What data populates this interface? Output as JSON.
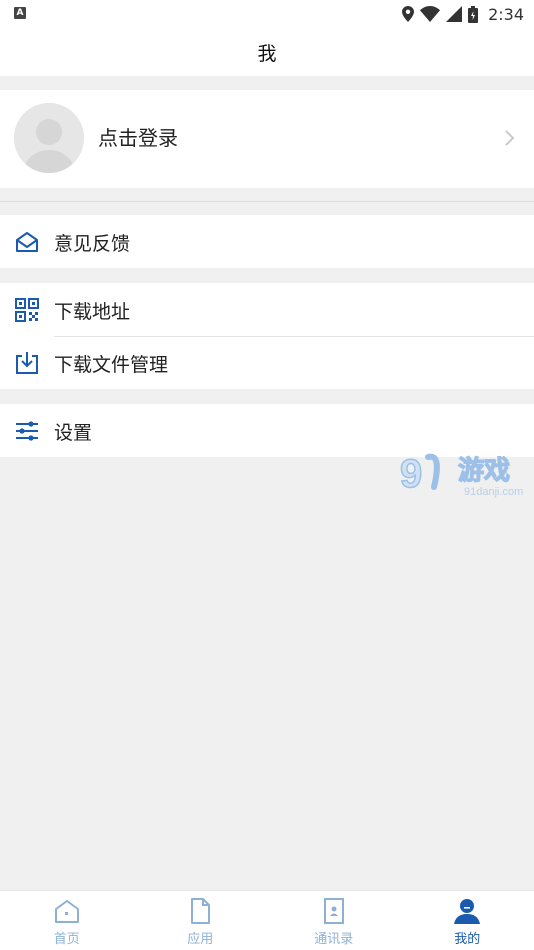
{
  "status_bar": {
    "left_badge": "A",
    "time": "2:34",
    "icons": [
      "location-icon",
      "wifi-icon",
      "signal-icon",
      "battery-icon"
    ]
  },
  "header": {
    "title": "我"
  },
  "profile": {
    "login_label": "点击登录",
    "avatar_icon": "avatar-placeholder"
  },
  "menu": {
    "group1": [
      {
        "label": "意见反馈",
        "icon": "mail-open-icon"
      }
    ],
    "group2": [
      {
        "label": "下载地址",
        "icon": "qr-code-icon"
      },
      {
        "label": "下载文件管理",
        "icon": "download-tray-icon"
      }
    ],
    "group3": [
      {
        "label": "设置",
        "icon": "sliders-icon"
      }
    ]
  },
  "watermark": {
    "brand": "9",
    "text": "游戏",
    "url": "91danji.com"
  },
  "bottom_nav": [
    {
      "label": "首页",
      "icon": "home-icon",
      "active": false
    },
    {
      "label": "应用",
      "icon": "file-icon",
      "active": false
    },
    {
      "label": "通讯录",
      "icon": "contacts-icon",
      "active": false
    },
    {
      "label": "我的",
      "icon": "person-icon",
      "active": true
    }
  ],
  "colors": {
    "accent": "#1a5bb0",
    "inactive": "#8fb0d6",
    "background": "#f0f0f0"
  }
}
